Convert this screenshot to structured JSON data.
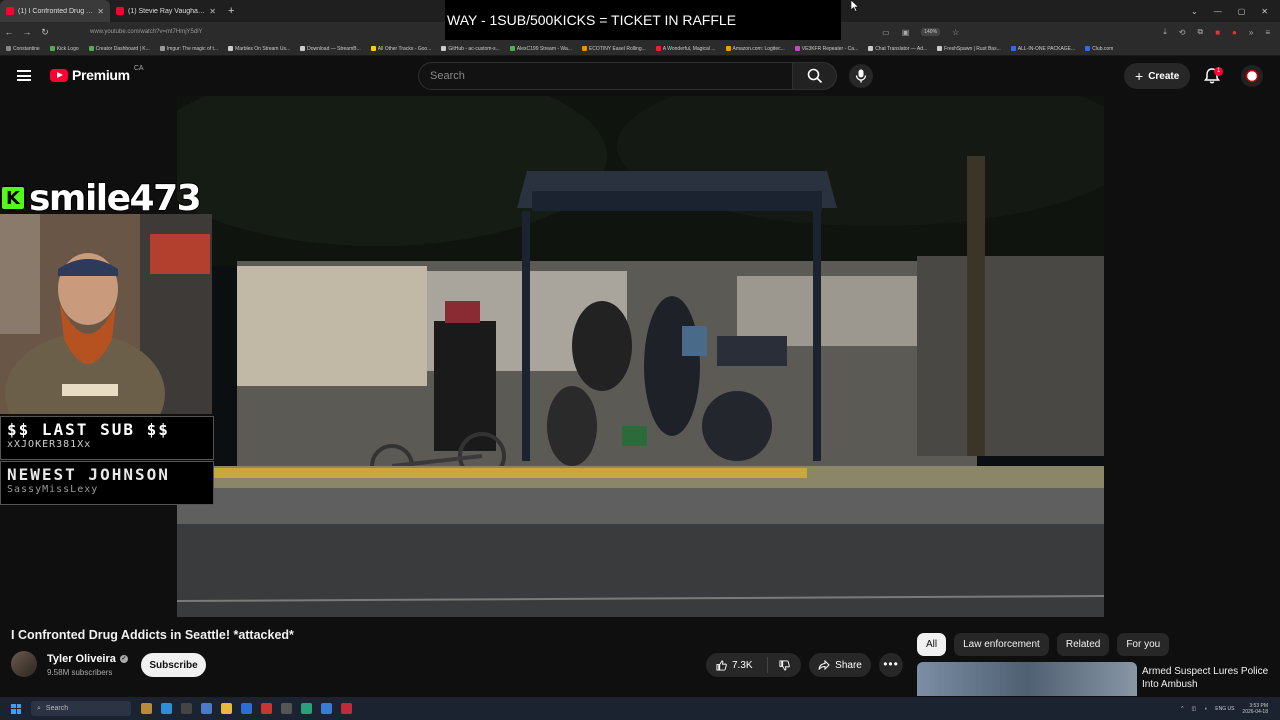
{
  "browser": {
    "tabs": [
      {
        "label": "(1) I Confronted Drug Addi",
        "active": true
      },
      {
        "label": "(1) Stevie Ray Vaughan - Texas",
        "active": false
      }
    ],
    "new_tab": "+",
    "url": "www.youtube.com/watch?v=mt7HmjY5dlY",
    "zoom": "140%",
    "bookmarks": [
      "Constantine",
      "Kick Logo",
      "Creator Dashboard | K...",
      "Imgur: The magic of t...",
      "Marbles On Stream Us...",
      "Download — StreamB...",
      "All Other Tracks - Goo...",
      "GitHub - ac-custom-s...",
      "AlexC199 Stream - Wa...",
      "ECOTINY Easel Rolling...",
      "A Wonderful, Magical ...",
      "Amazon.com: Logitec...",
      "VE3KFR Repeater - Ca...",
      "Chat Translator — Ad...",
      "FreshSpawn | Rust Bas...",
      "ALL-IN-ONE PACKAGE...",
      "Club.com"
    ]
  },
  "stream_overlay": {
    "ticker": "WAY - 1SUB/500KICKS = TICKET IN RAFFLE",
    "kick_username": "smile473",
    "kick_logo_letter": "K",
    "last_sub_label": "$$ LAST SUB $$",
    "last_sub_name": "xXJOKER381Xx",
    "newest_label": "NEWEST JOHNSON",
    "newest_name": "SassyMissLexy"
  },
  "youtube": {
    "logo_word": "Premium",
    "logo_region": "CA",
    "search_placeholder": "Search",
    "create_label": "Create",
    "notification_count": "1"
  },
  "video": {
    "title": "I Confronted Drug Addicts in Seattle! *attacked*",
    "channel_name": "Tyler Oliveira",
    "subscribers": "9.58M subscribers",
    "subscribe_label": "Subscribe",
    "likes": "7.3K",
    "share_label": "Share"
  },
  "sidebar": {
    "chips": [
      {
        "label": "All",
        "selected": true
      },
      {
        "label": "Law enforcement",
        "selected": false
      },
      {
        "label": "Related",
        "selected": false
      },
      {
        "label": "For you",
        "selected": false
      }
    ],
    "rec_title": "Armed Suspect Lures Police Into Ambush"
  },
  "taskbar": {
    "search_label": "Search",
    "time": "3:53 PM",
    "date": "2026-04-18",
    "lang": "ENG US"
  },
  "colors": {
    "youtube_red": "#ff0033",
    "kick_green": "#53fc18",
    "background": "#0f0f0f"
  }
}
